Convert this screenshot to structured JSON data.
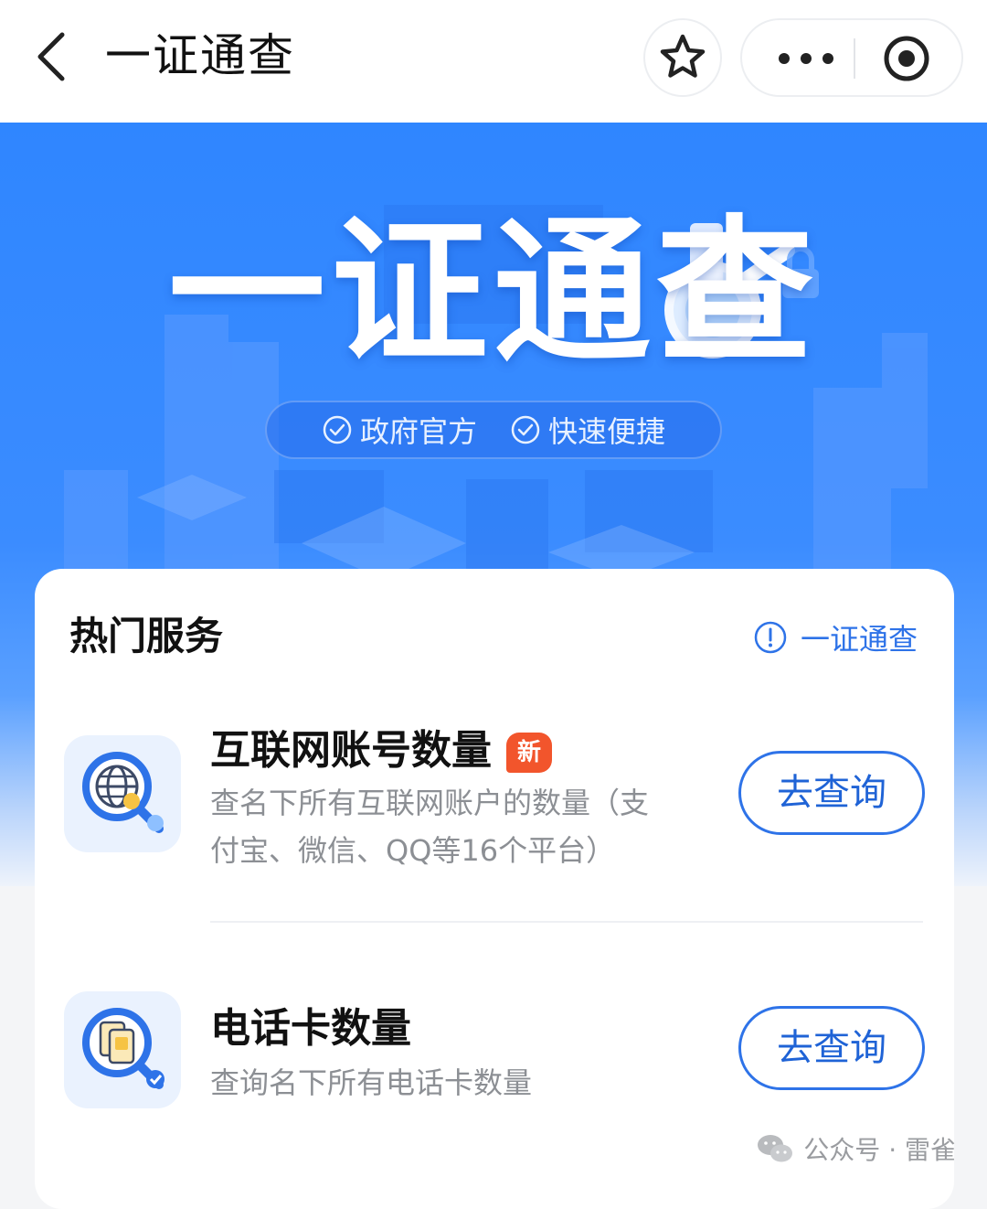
{
  "header": {
    "title": "一证通查"
  },
  "banner": {
    "title": "一证通查",
    "badges": [
      "政府官方",
      "快速便捷"
    ]
  },
  "section": {
    "title": "热门服务",
    "link_label": "一证通查"
  },
  "services": [
    {
      "name": "互联网账号数量",
      "badge": "新",
      "description_line1": "查名下所有互联网账户的数量（支",
      "description_line2": "付宝、微信、QQ等16个平台）",
      "button": "去查询",
      "icon": "globe-search-icon"
    },
    {
      "name": "电话卡数量",
      "description_line1": "查询名下所有电话卡数量",
      "button": "去查询",
      "icon": "sim-card-search-icon"
    }
  ],
  "watermark": {
    "text": "公众号 · 雷雀",
    "icon": "wechat-icon"
  },
  "colors": {
    "accent": "#2e73e8",
    "banner_blue": "#2f86ff",
    "new_badge": "#f2552c"
  }
}
